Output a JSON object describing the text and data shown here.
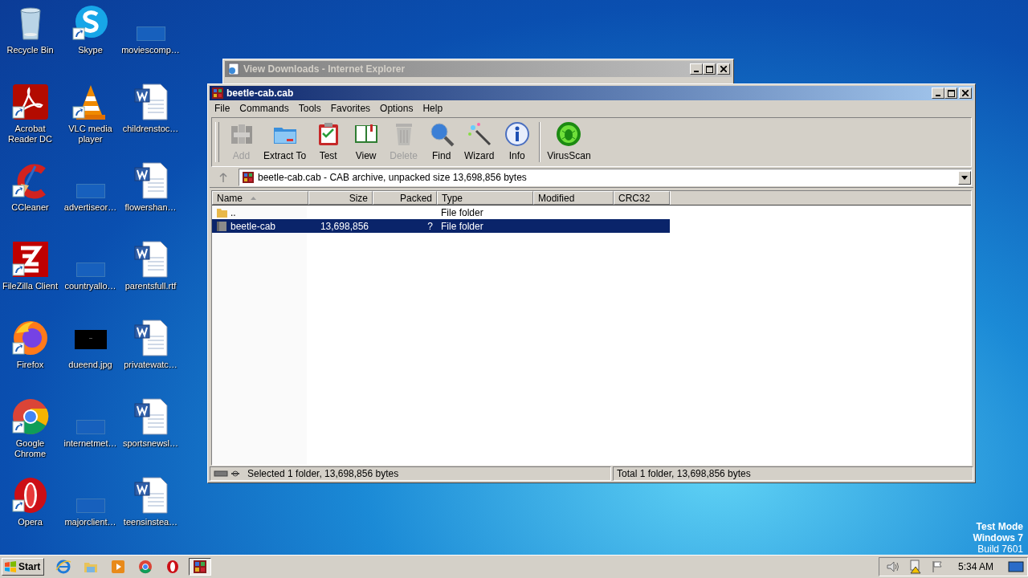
{
  "desktop_icons": [
    {
      "label": "Recycle Bin",
      "kind": "recycle",
      "shortcut": false
    },
    {
      "label": "Acrobat Reader DC",
      "kind": "acrobat",
      "shortcut": true
    },
    {
      "label": "CCleaner",
      "kind": "ccleaner",
      "shortcut": true
    },
    {
      "label": "FileZilla Client",
      "kind": "filezilla",
      "shortcut": true
    },
    {
      "label": "Firefox",
      "kind": "firefox",
      "shortcut": true
    },
    {
      "label": "Google Chrome",
      "kind": "chrome",
      "shortcut": true
    },
    {
      "label": "Opera",
      "kind": "opera",
      "shortcut": true
    },
    {
      "label": "Skype",
      "kind": "skype",
      "shortcut": true
    },
    {
      "label": "VLC media player",
      "kind": "vlc",
      "shortcut": true
    },
    {
      "label": "advertiseor…",
      "kind": "blank",
      "shortcut": false
    },
    {
      "label": "countryallo…",
      "kind": "blank",
      "shortcut": false
    },
    {
      "label": "dueend.jpg",
      "kind": "image",
      "shortcut": false
    },
    {
      "label": "internetmet…",
      "kind": "blank",
      "shortcut": false
    },
    {
      "label": "majorclient…",
      "kind": "blank",
      "shortcut": false
    },
    {
      "label": "moviescomp…",
      "kind": "blank",
      "shortcut": false
    },
    {
      "label": "childrenstoc…",
      "kind": "word",
      "shortcut": false
    },
    {
      "label": "flowershan…",
      "kind": "word",
      "shortcut": false
    },
    {
      "label": "parentsfull.rtf",
      "kind": "word",
      "shortcut": false
    },
    {
      "label": "privatewatc…",
      "kind": "word",
      "shortcut": false
    },
    {
      "label": "sportsnewsl…",
      "kind": "word",
      "shortcut": false
    },
    {
      "label": "teensinstea…",
      "kind": "word",
      "shortcut": false
    }
  ],
  "background_window": {
    "title": "View Downloads - Internet Explorer"
  },
  "window": {
    "title": "beetle-cab.cab",
    "menu": [
      "File",
      "Commands",
      "Tools",
      "Favorites",
      "Options",
      "Help"
    ],
    "toolbar": [
      {
        "label": "Add",
        "kind": "add",
        "disabled": true
      },
      {
        "label": "Extract To",
        "kind": "extract",
        "disabled": false
      },
      {
        "label": "Test",
        "kind": "test",
        "disabled": false
      },
      {
        "label": "View",
        "kind": "view",
        "disabled": false
      },
      {
        "label": "Delete",
        "kind": "delete",
        "disabled": true
      },
      {
        "label": "Find",
        "kind": "find",
        "disabled": false
      },
      {
        "label": "Wizard",
        "kind": "wizard",
        "disabled": false
      },
      {
        "label": "Info",
        "kind": "info",
        "disabled": false
      },
      {
        "label": "VirusScan",
        "kind": "virus",
        "disabled": false
      }
    ],
    "address": "beetle-cab.cab - CAB archive, unpacked size 13,698,856 bytes",
    "table": {
      "columns": [
        {
          "label": "Name",
          "kind": "text",
          "sorted": true
        },
        {
          "label": "Size",
          "kind": "number",
          "sorted": false
        },
        {
          "label": "Packed",
          "kind": "number",
          "sorted": false
        },
        {
          "label": "Type",
          "kind": "text",
          "sorted": false
        },
        {
          "label": "Modified",
          "kind": "text",
          "sorted": false
        },
        {
          "label": "CRC32",
          "kind": "text",
          "sorted": false
        }
      ],
      "rows": [
        {
          "kind": "parent",
          "cells": [
            "..",
            "",
            "",
            "File folder",
            "",
            ""
          ],
          "selected": false
        },
        {
          "kind": "folder",
          "cells": [
            "beetle-cab",
            "13,698,856",
            "?",
            "File folder",
            "",
            ""
          ],
          "selected": true
        }
      ]
    },
    "status_bar": {
      "left": "Selected 1 folder, 13,698,856 bytes",
      "right": "Total 1 folder, 13,698,856 bytes"
    }
  },
  "desktop_notice": [
    "Test Mode",
    "Windows 7",
    "Build 7601"
  ],
  "taskbar": {
    "start": "Start",
    "apps": [
      {
        "kind": "ie",
        "selected": false
      },
      {
        "kind": "explorer",
        "selected": false
      },
      {
        "kind": "media",
        "selected": false
      },
      {
        "kind": "chrome",
        "selected": false
      },
      {
        "kind": "opera",
        "selected": false
      },
      {
        "kind": "winrar",
        "selected": true
      }
    ],
    "clock": "5:34 AM"
  }
}
